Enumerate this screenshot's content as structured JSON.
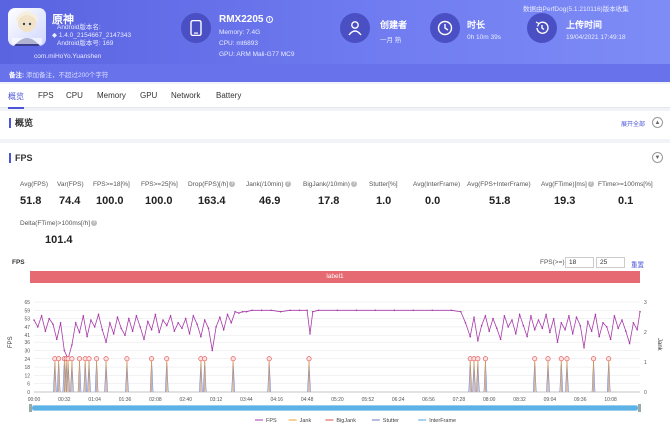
{
  "app": {
    "name": "原神",
    "android_version_label": "Android版本名:",
    "version_name": "1.4.0_2154667_2147343",
    "android_code_label": "Android版本号: 169",
    "package": "com.miHoYo.Yuanshen"
  },
  "device": {
    "name": "RMX2205",
    "memory": "Memory: 7.4G",
    "cpu": "CPU: mt6893",
    "gpu": "GPU: ARM Mali-G77 MC9"
  },
  "stats": [
    {
      "label": "创建者",
      "value": "一月 熟",
      "icon": "user-icon"
    },
    {
      "label": "时长",
      "value": "0h 10m 39s",
      "icon": "clock-icon"
    },
    {
      "label": "上传时间",
      "value": "19/04/2021 17:49:18",
      "icon": "history-icon"
    }
  ],
  "version_info": "数据由PerfDog(5.1.210116)版本收集",
  "notes": {
    "label": "备注:",
    "placeholder": "添加备注，不超过200个字符"
  },
  "tabs": [
    "概览",
    "FPS",
    "CPU",
    "Memory",
    "GPU",
    "Network",
    "Battery"
  ],
  "overview": {
    "title": "概览",
    "expand_all": "展开全部"
  },
  "fps_section": {
    "title": "FPS",
    "metrics": [
      {
        "label": "Avg(FPS)",
        "value": "51.8"
      },
      {
        "label": "Var(FPS)",
        "value": "74.4"
      },
      {
        "label": "FPS>=18[%]",
        "value": "100.0"
      },
      {
        "label": "FPS>=25[%]",
        "value": "100.0"
      },
      {
        "label": "Drop(FPS)[/h]",
        "value": "163.4",
        "help": true
      },
      {
        "label": "Jank(/10min)",
        "value": "46.9",
        "help": true
      },
      {
        "label": "BigJank(/10min)",
        "value": "17.8",
        "help": true
      },
      {
        "label": "Stutter[%]",
        "value": "1.0"
      },
      {
        "label": "Avg(InterFrame)",
        "value": "0.0"
      },
      {
        "label": "Avg(FPS+InterFrame)",
        "value": "51.8"
      },
      {
        "label": "Avg(FTime)[ms]",
        "value": "19.3",
        "help": true
      },
      {
        "label": "FTime>=100ms[%]",
        "value": "0.1"
      },
      {
        "label": "Delta(FTime)>100ms[/h]",
        "value": "101.4",
        "help": true
      }
    ]
  },
  "chart_controls": {
    "title": "FPS",
    "threshold_label": "FPS(>=)",
    "threshold_1": "18",
    "threshold_2": "25",
    "reset": "重置",
    "label_bar": "label1"
  },
  "chart_data": {
    "type": "line",
    "ylabel": "FPS",
    "y2label": "Jank",
    "y_ticks": [
      0,
      6,
      12,
      18,
      24,
      30,
      36,
      41,
      47,
      53,
      59,
      65
    ],
    "y2_ticks": [
      0,
      1,
      2,
      3
    ],
    "x_ticks": [
      "00:00",
      "00:32",
      "01:04",
      "01:36",
      "02:08",
      "02:40",
      "03:12",
      "03:44",
      "04:16",
      "04:48",
      "05:20",
      "05:52",
      "06:24",
      "06:56",
      "07:28",
      "08:00",
      "08:32",
      "09:04",
      "09:36",
      "10:08"
    ],
    "ylim": [
      0,
      65
    ],
    "xlim_seconds": [
      0,
      639
    ],
    "legend": [
      "FPS",
      "Jank",
      "BigJank",
      "Stutter",
      "InterFrame"
    ],
    "colors": {
      "FPS": "#a83aa8",
      "Jank": "#f0a030",
      "BigJank": "#e24b4b",
      "Stutter": "#6d7bc9",
      "InterFrame": "#4aa8e0"
    },
    "fps_points": [
      [
        0,
        52
      ],
      [
        4,
        47
      ],
      [
        8,
        55
      ],
      [
        12,
        44
      ],
      [
        16,
        53
      ],
      [
        20,
        49
      ],
      [
        24,
        38
      ],
      [
        28,
        50
      ],
      [
        32,
        30
      ],
      [
        36,
        24
      ],
      [
        40,
        34
      ],
      [
        44,
        50
      ],
      [
        48,
        43
      ],
      [
        52,
        55
      ],
      [
        56,
        40
      ],
      [
        60,
        52
      ],
      [
        64,
        47
      ],
      [
        68,
        56
      ],
      [
        72,
        45
      ],
      [
        76,
        36
      ],
      [
        80,
        50
      ],
      [
        84,
        42
      ],
      [
        88,
        54
      ],
      [
        92,
        46
      ],
      [
        96,
        41
      ],
      [
        100,
        53
      ],
      [
        104,
        44
      ],
      [
        108,
        55
      ],
      [
        112,
        47
      ],
      [
        116,
        38
      ],
      [
        120,
        51
      ],
      [
        124,
        45
      ],
      [
        128,
        56
      ],
      [
        132,
        43
      ],
      [
        136,
        52
      ],
      [
        140,
        48
      ],
      [
        144,
        55
      ],
      [
        148,
        44
      ],
      [
        152,
        50
      ],
      [
        156,
        46
      ],
      [
        160,
        53
      ],
      [
        164,
        42
      ],
      [
        168,
        55
      ],
      [
        172,
        49
      ],
      [
        176,
        40
      ],
      [
        180,
        52
      ],
      [
        184,
        46
      ],
      [
        188,
        30
      ],
      [
        192,
        47
      ],
      [
        196,
        54
      ],
      [
        200,
        45
      ],
      [
        204,
        56
      ],
      [
        208,
        50
      ],
      [
        212,
        58
      ],
      [
        216,
        57
      ],
      [
        220,
        58
      ],
      [
        224,
        58
      ],
      [
        230,
        59
      ],
      [
        240,
        59
      ],
      [
        250,
        59
      ],
      [
        260,
        58
      ],
      [
        270,
        59
      ],
      [
        280,
        59
      ],
      [
        288,
        59
      ],
      [
        291,
        42
      ],
      [
        294,
        58
      ],
      [
        300,
        59
      ],
      [
        320,
        59
      ],
      [
        340,
        59
      ],
      [
        360,
        59
      ],
      [
        380,
        59
      ],
      [
        400,
        59
      ],
      [
        420,
        59
      ],
      [
        440,
        59
      ],
      [
        450,
        58
      ],
      [
        455,
        50
      ],
      [
        460,
        40
      ],
      [
        464,
        54
      ],
      [
        468,
        37
      ],
      [
        472,
        48
      ],
      [
        476,
        55
      ],
      [
        480,
        44
      ],
      [
        484,
        53
      ],
      [
        488,
        46
      ],
      [
        492,
        38
      ],
      [
        496,
        55
      ],
      [
        500,
        47
      ],
      [
        504,
        52
      ],
      [
        508,
        42
      ],
      [
        512,
        56
      ],
      [
        516,
        48
      ],
      [
        520,
        40
      ],
      [
        524,
        55
      ],
      [
        528,
        45
      ],
      [
        532,
        52
      ],
      [
        536,
        46
      ],
      [
        540,
        56
      ],
      [
        544,
        43
      ],
      [
        548,
        53
      ],
      [
        552,
        36
      ],
      [
        556,
        50
      ],
      [
        560,
        45
      ],
      [
        564,
        55
      ],
      [
        568,
        42
      ],
      [
        572,
        54
      ],
      [
        576,
        48
      ],
      [
        580,
        32
      ],
      [
        584,
        51
      ],
      [
        588,
        44
      ],
      [
        592,
        56
      ],
      [
        596,
        40
      ],
      [
        600,
        50
      ],
      [
        604,
        47
      ],
      [
        608,
        38
      ],
      [
        612,
        55
      ],
      [
        616,
        46
      ],
      [
        620,
        52
      ],
      [
        624,
        44
      ],
      [
        628,
        35
      ],
      [
        632,
        50
      ],
      [
        636,
        45
      ],
      [
        639,
        58
      ]
    ],
    "jank_spikes_seconds": [
      22,
      26,
      32,
      34,
      36,
      40,
      48,
      54,
      58,
      66,
      76,
      98,
      124,
      140,
      176,
      180,
      210,
      248,
      290,
      460,
      464,
      468,
      476,
      528,
      542,
      556,
      562,
      590,
      606
    ]
  },
  "legend_labels": [
    "FPS",
    "Jank",
    "BigJank",
    "Stutter",
    "InterFrame"
  ]
}
